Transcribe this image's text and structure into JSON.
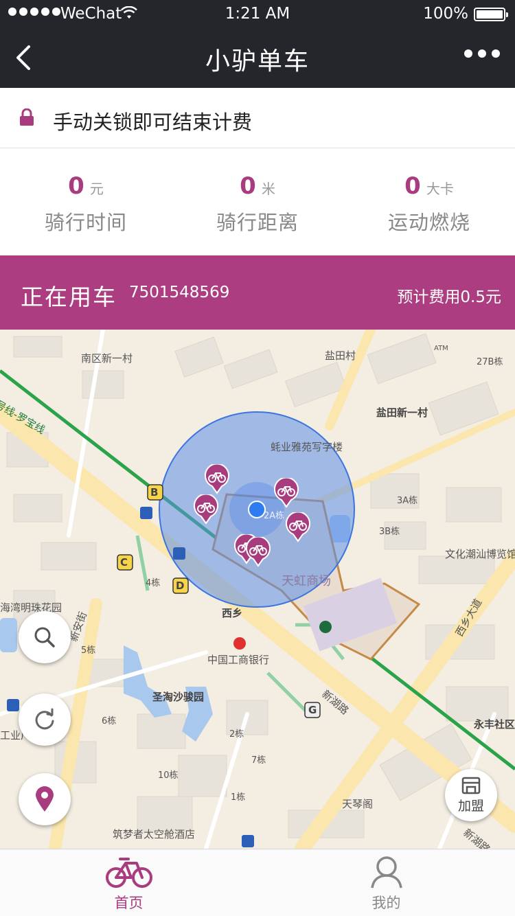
{
  "status_bar": {
    "carrier": "WeChat",
    "time": "1:21 AM",
    "battery": "100%"
  },
  "nav": {
    "title": "小驴单车"
  },
  "notice": {
    "text": "手动关锁即可结束计费"
  },
  "stats": [
    {
      "value": "0",
      "unit": "元",
      "label": "骑行时间"
    },
    {
      "value": "0",
      "unit": "米",
      "label": "骑行距离"
    },
    {
      "value": "0",
      "unit": "大卡",
      "label": "运动燃烧"
    }
  ],
  "banner": {
    "title": "正在用车",
    "bike_id": "7501548569",
    "fee": "预计费用0.5元"
  },
  "map": {
    "labels": {
      "nanqu": "南区新一村",
      "yantian_cun": "盐田村",
      "yantian_new": "盐田新一村",
      "atm": "ATM",
      "b27": "27B栋",
      "haoye": "蚝业雅苑写字楼",
      "b3a": "3A栋",
      "b3b": "3B栋",
      "b2a": "2A栋",
      "wenhua": "文化潮汕博览馆",
      "tianhong": "天虹商场",
      "b4": "4栋",
      "haiwan": "海湾明珠花园",
      "xixiang": "西乡",
      "b5": "5栋",
      "icbc": "中国工商银行",
      "shengtao": "圣淘沙骏园",
      "b6": "6栋",
      "b2": "2栋",
      "b7": "7栋",
      "b10": "10栋",
      "b1": "1栋",
      "tianqin": "天琴阁",
      "zhumeng": "筑梦者太空舱酒店",
      "yongfeng": "永丰社区",
      "gongye": "工业厂",
      "line_name": "号线-罗宝线",
      "xinhu_road": "新湖路",
      "xinhu_road2": "新湖路",
      "xixiang_ave": "西乡大道",
      "road_left": "新安街"
    },
    "metro_markers": [
      "B",
      "C",
      "D",
      "G"
    ],
    "bike_count": 6,
    "join_label": "加盟"
  },
  "tabs": [
    {
      "label": "首页",
      "active": true
    },
    {
      "label": "我的",
      "active": false
    }
  ],
  "colors": {
    "accent": "#ab3d80",
    "nav_bg": "#25262b",
    "circle": "#5b8ee8"
  },
  "icons": {
    "lock": "lock-icon",
    "back": "chevron-left-icon",
    "more": "more-dots-icon",
    "search": "search-icon",
    "refresh": "refresh-icon",
    "locate": "location-pin-icon",
    "join": "shop-icon",
    "home": "bike-icon",
    "profile": "person-icon"
  }
}
